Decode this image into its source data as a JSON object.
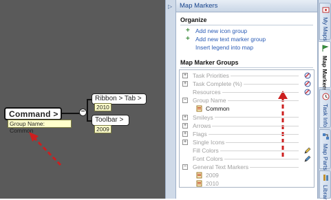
{
  "canvas": {
    "central_topic": "Command >",
    "central_tag": "Group Name: Common",
    "subtopics": [
      {
        "label": "Ribbon > Tab >",
        "tag": "2010"
      },
      {
        "label": "Toolbar >",
        "tag": "2009"
      }
    ],
    "collapse_symbol": "−",
    "annotation_color": "#cc1f1f"
  },
  "splitter": {
    "arrow": "▷"
  },
  "pane": {
    "title": "Map Markers",
    "organize": {
      "heading": "Organize",
      "links": [
        {
          "label": "Add new icon group",
          "icon": "plus-icon"
        },
        {
          "label": "Add new text marker group",
          "icon": "plus-icon"
        },
        {
          "label": "Insert legend into map",
          "icon": ""
        }
      ]
    },
    "groups": {
      "heading": "Map Marker Groups",
      "items": [
        {
          "label": "Task Priorities",
          "expander": "+",
          "icon": "edit-marker-icon"
        },
        {
          "label": "Task Complete (%)",
          "expander": "+",
          "icon": "edit-marker-icon"
        },
        {
          "label": "Resources",
          "expander": "",
          "icon": "edit-marker-icon"
        },
        {
          "label": "Group Name",
          "expander": "−",
          "icon": ""
        },
        {
          "label": "Common",
          "child": true,
          "icon": "flag-marker-icon"
        },
        {
          "label": "Smileys",
          "expander": "+",
          "icon": ""
        },
        {
          "label": "Arrows",
          "expander": "+",
          "icon": ""
        },
        {
          "label": "Flags",
          "expander": "+",
          "icon": ""
        },
        {
          "label": "Single Icons",
          "expander": "+",
          "icon": ""
        },
        {
          "label": "Fill Colors",
          "expander": "",
          "icon": "pencil-icon"
        },
        {
          "label": "Font Colors",
          "expander": "",
          "icon": "pencil-icon"
        },
        {
          "label": "General Text Markers",
          "expander": "−",
          "icon": ""
        },
        {
          "label": "2009",
          "child": true,
          "icon": "flag-marker-icon"
        },
        {
          "label": "2010",
          "child": true,
          "icon": "flag-marker-icon"
        }
      ]
    }
  },
  "tabs": [
    {
      "label": "My Maps",
      "icon": "my-maps-icon",
      "active": false
    },
    {
      "label": "Map Markers",
      "icon": "map-markers-icon",
      "active": true
    },
    {
      "label": "Task Info",
      "icon": "task-info-icon",
      "active": false
    },
    {
      "label": "Map Parts",
      "icon": "map-parts-icon",
      "active": false
    },
    {
      "label": "Librar",
      "icon": "library-icon",
      "active": false
    }
  ]
}
